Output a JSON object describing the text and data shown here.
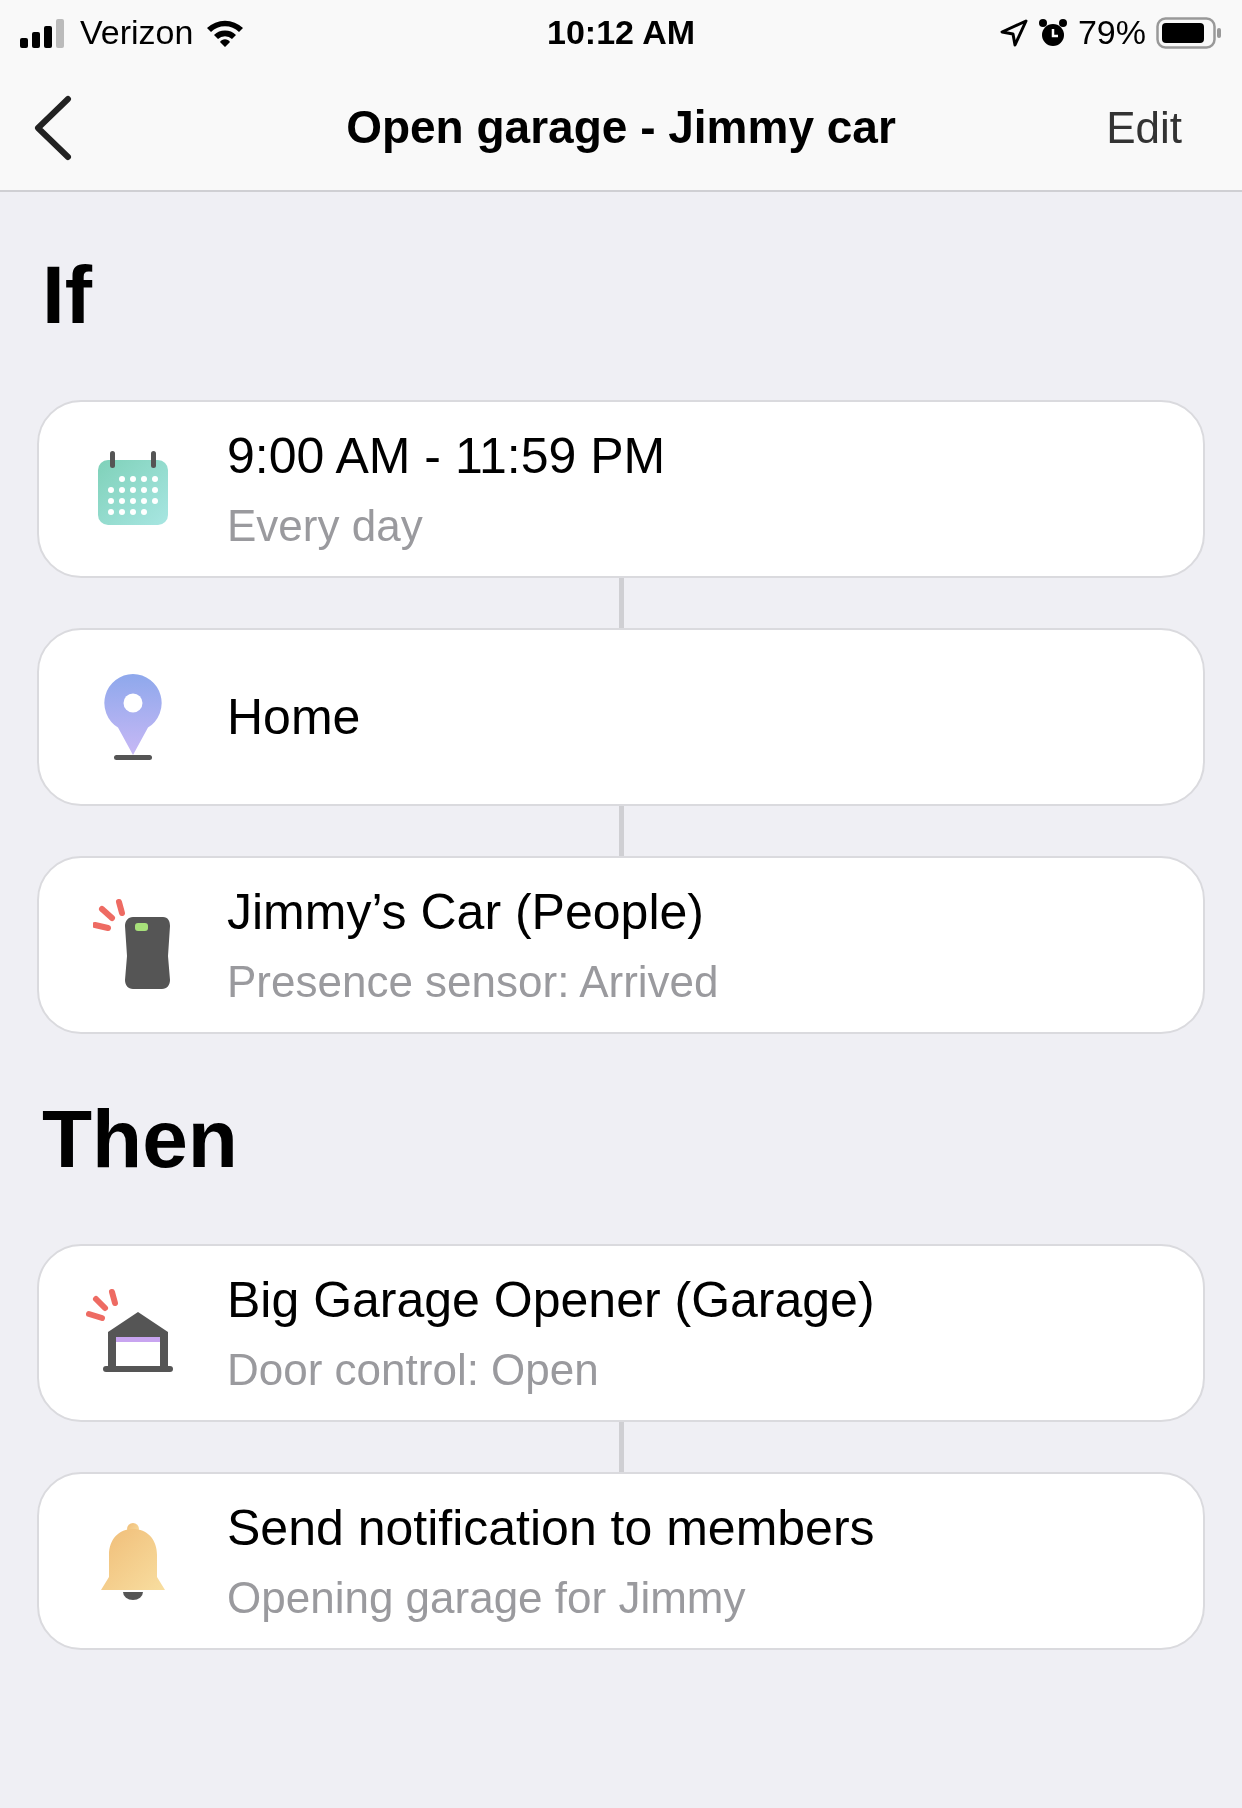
{
  "status_bar": {
    "carrier": "Verizon",
    "time": "10:12 AM",
    "battery": "79%"
  },
  "nav": {
    "title": "Open garage - Jimmy car",
    "action": "Edit"
  },
  "sections": [
    {
      "heading": "If",
      "items": [
        {
          "kind": "calendar",
          "title": "9:00 AM - 11:59 PM",
          "subtitle": "Every day"
        },
        {
          "kind": "location",
          "title": "Home"
        },
        {
          "kind": "sensor",
          "title": "Jimmy’s Car (People)",
          "subtitle": "Presence sensor: Arrived"
        }
      ]
    },
    {
      "heading": "Then",
      "items": [
        {
          "kind": "garage",
          "title": "Big Garage Opener (Garage)",
          "subtitle": "Door control: Open"
        },
        {
          "kind": "bell",
          "title": "Send notification to members",
          "subtitle": "Opening garage for Jimmy"
        }
      ]
    }
  ]
}
